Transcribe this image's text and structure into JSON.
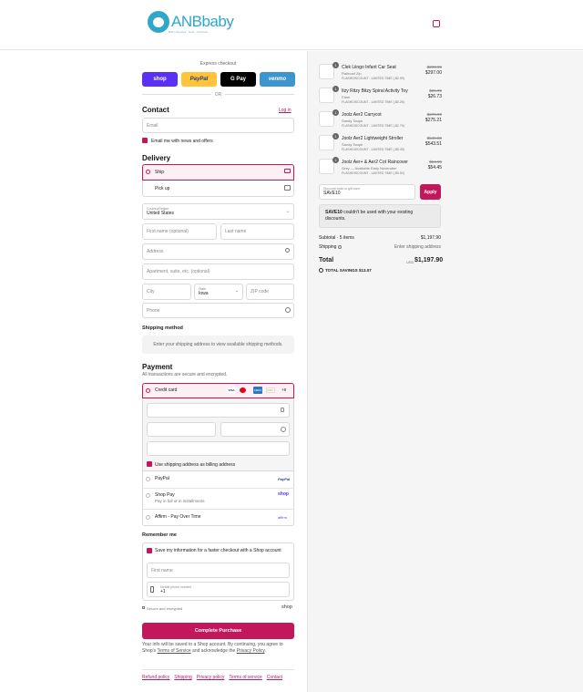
{
  "header": {
    "brand": "ANBbaby",
    "tagline": "Baby Supplies · Gear · Furniture"
  },
  "express": {
    "title": "Express checkout",
    "buttons": [
      "shop",
      "PayPal",
      "G Pay",
      "venmo"
    ],
    "or": "OR"
  },
  "contact": {
    "title": "Contact",
    "login": "Log in",
    "email_placeholder": "Email",
    "news_label": "Email me with news and offers"
  },
  "delivery": {
    "title": "Delivery",
    "options": [
      "Ship",
      "Pick up"
    ],
    "country_label": "Country/Region",
    "country_value": "United States",
    "first_name": "First name (optional)",
    "last_name": "Last name",
    "address": "Address",
    "apartment": "Apartment, suite, etc. (optional)",
    "city": "City",
    "state_label": "State",
    "state_value": "Iowa",
    "zip": "ZIP code",
    "phone": "Phone"
  },
  "shipping_method": {
    "title": "Shipping method",
    "note": "Enter your shipping address to view available shipping methods."
  },
  "payment": {
    "title": "Payment",
    "subtitle": "All transactions are secure and encrypted.",
    "credit_card": "Credit card",
    "card_more": "+8",
    "billing_label": "Use shipping address as billing address",
    "paypal": "PayPal",
    "paypal_logo": "PayPal",
    "shoppay": "Shop Pay",
    "shoppay_sub": "Pay in full or in installments",
    "shoppay_logo": "shop",
    "affirm": "Affirm - Pay Over Time",
    "affirm_logo": "affirm"
  },
  "remember": {
    "title": "Remember me",
    "save_label": "Save my information for a faster checkout with a Shop account",
    "first_name": "First name",
    "mobile_label": "Mobile phone number",
    "mobile_value": "+1",
    "secure": "Secure and encrypted",
    "shop_logo": "shop"
  },
  "complete_button": "Complete Purchase",
  "consent": {
    "pre": "Your info will be saved to a Shop account. By continuing, you agree to Shop's ",
    "tos": "Terms of Service",
    "mid": " and acknowledge the ",
    "privacy": "Privacy Policy",
    "end": "."
  },
  "footer_links": [
    "Refund policy",
    "Shipping",
    "Privacy policy",
    "Terms of service",
    "Contact"
  ],
  "cart": {
    "items": [
      {
        "name": "Clek Liingo Infant Car Seat",
        "variant": "Railroad Zip",
        "discount": "FLASHDISCOUNT - LIMITED TIME (-$2.99)",
        "old": "$299.99",
        "price": "$297.00",
        "qty": "1"
      },
      {
        "name": "Itzy Ritzy Bitzy Spiral Activity Toy",
        "variant": "Farm",
        "discount": "FLASHDISCOUNT - LIMITED TIME (-$0.26)",
        "old": "$25.99",
        "price": "$26.73",
        "qty": "1"
      },
      {
        "name": "Joolz Aer2 Carrycot",
        "variant": "Sandy Taupe",
        "discount": "FLASHDISCOUNT - LIMITED TIME (-$2.79)",
        "old": "$279.00",
        "price": "$275.21",
        "qty": "1"
      },
      {
        "name": "Joolz Aer2 Lightweight Stroller",
        "variant": "Sandy Taupe",
        "discount": "FLASHDISCOUNT - LIMITED TIME (-$5.49)",
        "old": "$549.00",
        "price": "$543.51",
        "qty": "1"
      },
      {
        "name": "Joolz Aer+ & Aer2 Cot Raincover",
        "variant": "Grey — Available Early November",
        "discount": "FLASHDISCOUNT - LIMITED TIME (-$0.54)",
        "old": "$54.99",
        "price": "$54.45",
        "qty": "1"
      }
    ],
    "discount_label": "Discount code or gift card",
    "discount_value": "SAVE10",
    "apply": "Apply",
    "error_code": "SAVE10",
    "error_text": " couldn't be used with your existing discounts.",
    "subtotal_label": "Subtotal · 5 items",
    "subtotal": "$1,197.90",
    "shipping_label": "Shipping",
    "shipping_value": "Enter shipping address",
    "total_label": "Total",
    "currency": "USD",
    "total": "$1,197.90",
    "savings_label": "TOTAL SAVINGS",
    "savings": "$13.07"
  },
  "colors": {
    "accent": "#c2185b",
    "brand": "#2fa8c8"
  }
}
